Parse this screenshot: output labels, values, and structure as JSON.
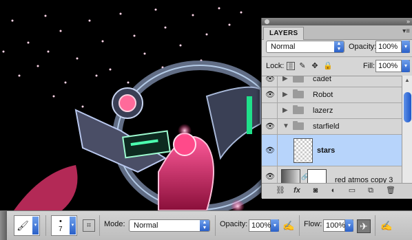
{
  "layers_panel": {
    "tab_label": "LAYERS",
    "blend_mode": "Normal",
    "opacity_label": "Opacity:",
    "opacity_value": "100%",
    "lock_label": "Lock:",
    "fill_label": "Fill:",
    "fill_value": "100%",
    "layers": [
      {
        "name": "cadet",
        "type": "group",
        "visible": true
      },
      {
        "name": "Robot",
        "type": "group",
        "visible": true
      },
      {
        "name": "lazerz",
        "type": "group",
        "visible": false
      },
      {
        "name": "starfield",
        "type": "group",
        "visible": true,
        "expanded": true
      },
      {
        "name": "stars",
        "type": "layer",
        "visible": true,
        "selected": true
      },
      {
        "name": "red atmos copy 3",
        "type": "layer",
        "visible": true
      }
    ],
    "footer_icons": [
      "link-icon",
      "fx-icon",
      "mask-icon",
      "adjustment-icon",
      "folder-icon",
      "new-layer-icon",
      "trash-icon"
    ]
  },
  "options_bar": {
    "brush_size": "7",
    "mode_label": "Mode:",
    "mode_value": "Normal",
    "opacity_label": "Opacity:",
    "opacity_value": "100%",
    "flow_label": "Flow:",
    "flow_value": "100%"
  },
  "colors": {
    "selected_layer": "#b7d4fb",
    "accent_blue": "#2a60c8",
    "panel_bg": "#d6d6d6"
  }
}
